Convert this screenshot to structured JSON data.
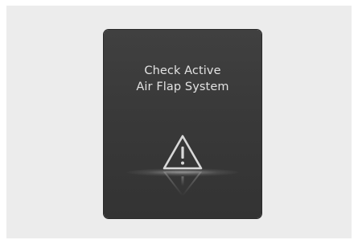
{
  "cluster_display": {
    "message": {
      "line1": "Check Active",
      "line2": "Air Flap System"
    },
    "icon": "warning-triangle-icon"
  },
  "colors": {
    "background": "#ececec",
    "display": "#3a3a3a",
    "text": "#e2e2e2",
    "icon": "#d8d8d8"
  }
}
